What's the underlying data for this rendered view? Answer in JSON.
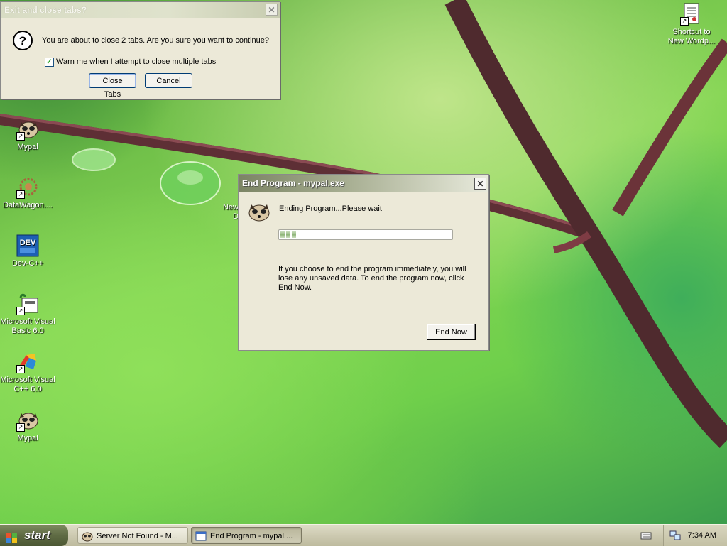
{
  "desktop": {
    "icons": [
      {
        "label": "Shortcut to New Wordp...",
        "icon": "wordpad-document-icon"
      },
      {
        "label": "Mypal",
        "icon": "mypal-raccoon-icon"
      },
      {
        "label": "DataWagon....",
        "icon": "datawagon-icon"
      },
      {
        "label": "Dev-C++",
        "icon": "dev-cpp-icon"
      },
      {
        "label": "Microsoft Visual Basic 6.0",
        "icon": "visual-basic-icon"
      },
      {
        "label": "Microsoft Visual C++ 6.0",
        "icon": "visual-cpp-icon"
      },
      {
        "label": "Mypal",
        "icon": "mypal-raccoon-icon"
      },
      {
        "label": "New",
        "label2": "D",
        "icon": "hidden-icon"
      }
    ]
  },
  "close_tabs_dialog": {
    "title": "Exit and close tabs?",
    "message": "You are about to close 2 tabs. Are you sure you want to continue?",
    "checkbox_label": "Warn me when I attempt to close multiple tabs",
    "checkbox_checked": true,
    "close_tabs_label": "Close Tabs",
    "cancel_label": "Cancel",
    "icon": "question-icon"
  },
  "end_program_dialog": {
    "title": "End Program - mypal.exe",
    "status": "Ending Program...Please wait",
    "progress_segments_filled": 3,
    "info_text": "If you choose to end the program immediately, you will lose any unsaved data. To end the program now, click End Now.",
    "end_now_label": "End Now",
    "icon": "mypal-raccoon-icon"
  },
  "taskbar": {
    "start_label": "start",
    "tasks": [
      {
        "label": "Server Not Found - M...",
        "active": false,
        "icon": "mypal-raccoon-icon"
      },
      {
        "label": "End Program - mypal....",
        "active": true,
        "icon": "window-icon"
      }
    ],
    "clock": "7:34 AM"
  },
  "colors": {
    "dialog_bg": "#ece9d8",
    "taskbar": "#cdcab1",
    "start_button": "#5f6b44"
  }
}
